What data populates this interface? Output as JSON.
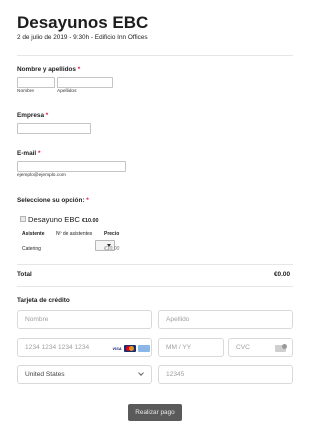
{
  "header": {
    "title": "Desayunos EBC",
    "subtitle": "2 de julio de 2019 - 9:30h - Edificio Inn Offices"
  },
  "fields": {
    "full_name": {
      "label": "Nombre y apellidos",
      "required_mark": "*",
      "first_sublabel": "Nombre",
      "last_sublabel": "Apellidos",
      "first_value": "",
      "last_value": ""
    },
    "company": {
      "label": "Empresa",
      "required_mark": "*",
      "value": ""
    },
    "email": {
      "label": "E-mail",
      "required_mark": "*",
      "value": "",
      "sublabel": "ejemplo@ejemplo.com"
    },
    "option": {
      "label": "Seleccione su opción:",
      "required_mark": "*"
    }
  },
  "product": {
    "name": "Desayuno EBC",
    "price": "€10.00",
    "checked": false,
    "table": {
      "headers": [
        "Asistente",
        "Nº de asistentes",
        "Precio"
      ],
      "row": {
        "asistente": "Catering",
        "asistentes_value": "",
        "precio": "€10,00"
      }
    }
  },
  "total": {
    "label": "Total",
    "value": "€0.00"
  },
  "payment": {
    "section_label": "Tarjeta de crédito",
    "first_name_placeholder": "Nombre",
    "last_name_placeholder": "Apellido",
    "card_number_placeholder": "1234 1234 1234 1234",
    "card_brands": [
      "VISA",
      "mastercard-icon",
      "amex-icon"
    ],
    "expiry_placeholder": "MM / YY",
    "cvc_placeholder": "CVC",
    "country_value": "United States",
    "zip_placeholder": "12345"
  },
  "submit_label": "Realizar pago"
}
